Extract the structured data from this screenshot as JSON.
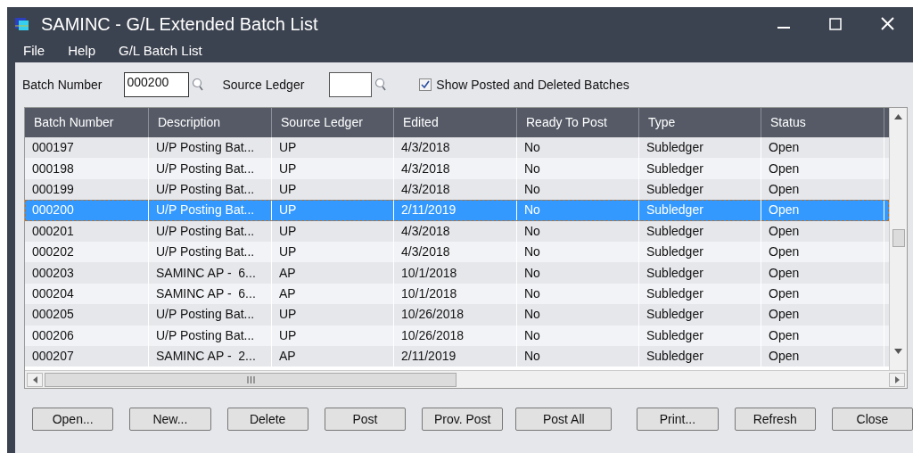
{
  "window": {
    "title": "SAMINC - G/L Extended Batch List"
  },
  "menu": [
    {
      "label": "File"
    },
    {
      "label": "Help"
    },
    {
      "label": "G/L Batch List"
    }
  ],
  "filters": {
    "batch_number": {
      "label": "Batch Number",
      "value": "000200"
    },
    "source_ledger": {
      "label": "Source Ledger"
    },
    "show_posted": {
      "label": "Show Posted and Deleted Batches",
      "checked": true
    }
  },
  "table": {
    "columns": [
      "Batch Number",
      "Description",
      "Source Ledger",
      "Edited",
      "Ready To Post",
      "Type",
      "Status"
    ],
    "rows": [
      {
        "cells": [
          "000197",
          "U/P Posting Bat...",
          "UP",
          "4/3/2018",
          "No",
          "Subledger",
          "Open"
        ],
        "selected": false
      },
      {
        "cells": [
          "000198",
          "U/P Posting Bat...",
          "UP",
          "4/3/2018",
          "No",
          "Subledger",
          "Open"
        ],
        "selected": false
      },
      {
        "cells": [
          "000199",
          "U/P Posting Bat...",
          "UP",
          "4/3/2018",
          "No",
          "Subledger",
          "Open"
        ],
        "selected": false
      },
      {
        "cells": [
          "000200",
          "U/P Posting Bat...",
          "UP",
          "2/11/2019",
          "No",
          "Subledger",
          "Open"
        ],
        "selected": true
      },
      {
        "cells": [
          "000201",
          "U/P Posting Bat...",
          "UP",
          "4/3/2018",
          "No",
          "Subledger",
          "Open"
        ],
        "selected": false
      },
      {
        "cells": [
          "000202",
          "U/P Posting Bat...",
          "UP",
          "4/3/2018",
          "No",
          "Subledger",
          "Open"
        ],
        "selected": false
      },
      {
        "cells": [
          "000203",
          "SAMINC AP -  6...",
          "AP",
          "10/1/2018",
          "No",
          "Subledger",
          "Open"
        ],
        "selected": false
      },
      {
        "cells": [
          "000204",
          "SAMINC AP -  6...",
          "AP",
          "10/1/2018",
          "No",
          "Subledger",
          "Open"
        ],
        "selected": false
      },
      {
        "cells": [
          "000205",
          "U/P Posting Bat...",
          "UP",
          "10/26/2018",
          "No",
          "Subledger",
          "Open"
        ],
        "selected": false
      },
      {
        "cells": [
          "000206",
          "U/P Posting Bat...",
          "UP",
          "10/26/2018",
          "No",
          "Subledger",
          "Open"
        ],
        "selected": false
      },
      {
        "cells": [
          "000207",
          "SAMINC AP -  2...",
          "AP",
          "2/11/2019",
          "No",
          "Subledger",
          "Open"
        ],
        "selected": false
      }
    ]
  },
  "buttons": [
    {
      "label": "Open..."
    },
    {
      "label": "New..."
    },
    {
      "label": "Delete"
    },
    {
      "label": "Post"
    },
    {
      "label": "Prov. Post"
    },
    {
      "label": "Post All"
    },
    {
      "label": "Print..."
    },
    {
      "label": "Refresh"
    },
    {
      "label": "Close"
    }
  ]
}
